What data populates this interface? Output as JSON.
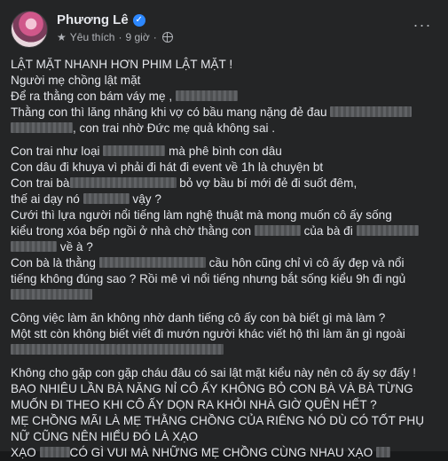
{
  "post": {
    "author": "Phương Lê",
    "meta_label": "Yêu thích",
    "time": "9 giờ",
    "lines": {
      "l1a": "LẬT MẶT NHANH HƠN PHIM LẬT MẶT !",
      "l2a": "Người mẹ chồng lật mặt",
      "l3a": "Để ra thằng con bám váy mẹ ,",
      "l4a": "Thằng con thì lăng nhăng khi vợ có bầu mang nặng đẻ đau",
      "l5a": ", con trai nhờ Đức mẹ quả không sai .",
      "l6a": "Con trai như loại",
      "l6b": "mà phê bình con dâu",
      "l7a": "Con dâu đi khuya vì phải đi hát đi event về 1h là chuyện bt",
      "l8a": "Con trai bà",
      "l8b": "bỏ vợ bầu bí mới đẻ đi suốt đêm,",
      "l9a": "thế ai dạy nó",
      "l9b": "vậy ?",
      "l10a": "Cưới thì lựa người nổi tiếng làm nghệ thuật mà mong muốn cô ấy sống",
      "l11a": "kiểu trong xóa bếp ngồi ở nhà chờ thằng con",
      "l11b": "của bà đi",
      "l12a": "về à ?",
      "l13a": "Con bà là thằng",
      "l13b": "cầu hôn cũng chỉ vì cô ấy đẹp và nổi",
      "l14a": "tiếng không đúng sao ? Rồi mê vì nổi tiếng nhưng bắt sống kiểu 9h đi ngủ",
      "l15a": "Công việc làm ăn không nhờ danh tiếng cô ấy con bà biết gì mà làm ?",
      "l16a": "Một stt còn không biết viết đi mướn người khác viết hộ thì làm ăn gì ngoài",
      "l17a": "Không cho gặp con gặp cháu đâu có sai lật mặt kiểu này nên cô ấy sợ đấy !",
      "l18a": "BAO NHIÊU LẦN BÀ NĂNG NỈ CÔ ẤY KHÔNG BỎ CON BÀ VÀ BÀ TỪNG",
      "l19a": "MUỐN ĐI THEO KHI CÔ ẤY DỌN RA KHỎI NHÀ GIỜ QUÊN HẾT ?",
      "l20a": "MẸ CHỒNG MÃI LÀ MẸ THẰNG CHỒNG CỦA RIÊNG NÓ DÙ CÓ TỐT PHỤ",
      "l21a": "NỮ CŨNG NÊN HIỂU ĐÓ LÀ XẠO",
      "l22a": "XẠO",
      "l22b": "CÓ GÌ VUI MÀ NHỮNG MẸ CHỒNG CÙNG NHAU XẠO"
    }
  },
  "colors": {
    "background": "#242526",
    "text": "#e4e6eb",
    "secondary": "#b0b3b8",
    "verified": "#2d88ff"
  },
  "icons": {
    "verified": "verified-badge-icon",
    "meta": "star-icon",
    "privacy": "globe-icon",
    "more": "more-options-icon"
  }
}
